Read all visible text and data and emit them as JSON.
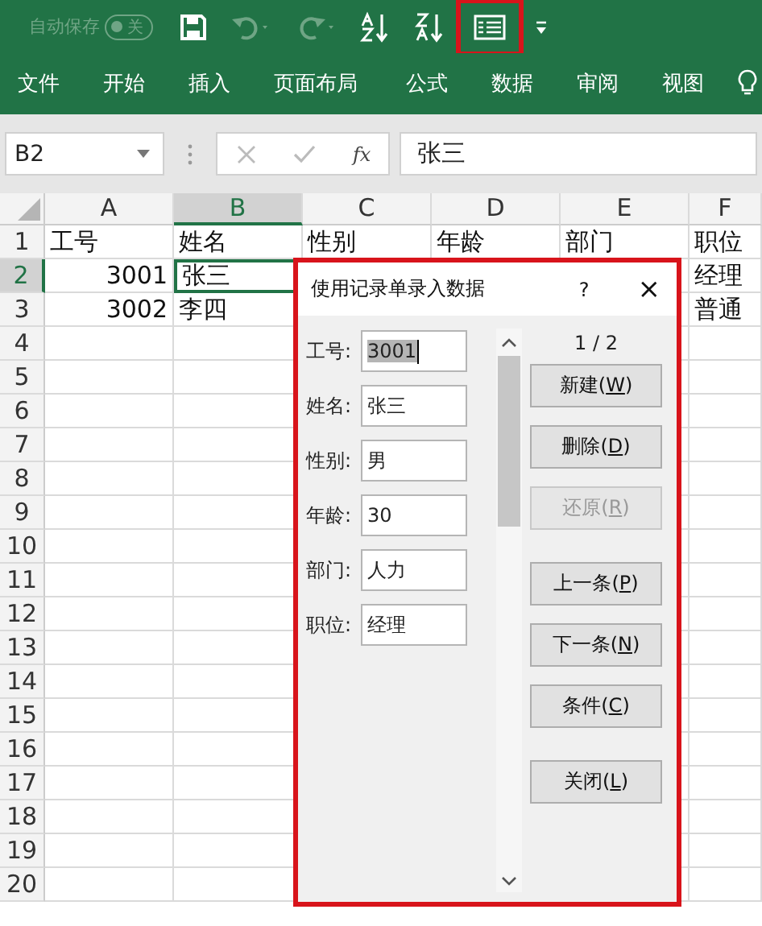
{
  "quick_access": {
    "autosave": {
      "label": "自动保存",
      "state_text": "关",
      "on": false
    },
    "tools": [
      {
        "kind": "save",
        "disabled": false,
        "highlighted": false
      },
      {
        "kind": "undo",
        "disabled": true,
        "highlighted": false
      },
      {
        "kind": "redo",
        "disabled": true,
        "highlighted": false
      },
      {
        "kind": "sort-asc",
        "disabled": false,
        "highlighted": false
      },
      {
        "kind": "sort-desc",
        "disabled": false,
        "highlighted": false
      },
      {
        "kind": "form",
        "disabled": false,
        "highlighted": true
      },
      {
        "kind": "customize",
        "disabled": false,
        "highlighted": false
      }
    ]
  },
  "ribbon_tabs": [
    {
      "label": "文件"
    },
    {
      "label": "开始"
    },
    {
      "label": "插入"
    },
    {
      "label": "页面布局"
    },
    {
      "label": "公式"
    },
    {
      "label": "数据"
    },
    {
      "label": "审阅"
    },
    {
      "label": "视图"
    }
  ],
  "formula_bar": {
    "name_box": "B2",
    "function_label": "fx",
    "content": "张三"
  },
  "sheet": {
    "columns": [
      {
        "label": "A",
        "selected": false
      },
      {
        "label": "B",
        "selected": true
      },
      {
        "label": "C",
        "selected": false
      },
      {
        "label": "D",
        "selected": false
      },
      {
        "label": "E",
        "selected": false
      },
      {
        "label": "F",
        "selected": false
      }
    ],
    "rows": [
      {
        "label": "1",
        "selected": false,
        "cells": [
          {
            "text": "工号",
            "kind": "text",
            "active": false
          },
          {
            "text": "姓名",
            "kind": "text",
            "active": false
          },
          {
            "text": "性别",
            "kind": "text",
            "active": false
          },
          {
            "text": "年龄",
            "kind": "text",
            "active": false
          },
          {
            "text": "部门",
            "kind": "text",
            "active": false
          },
          {
            "text": "职位",
            "kind": "text",
            "active": false
          }
        ]
      },
      {
        "label": "2",
        "selected": true,
        "cells": [
          {
            "text": "3001",
            "kind": "number",
            "active": false
          },
          {
            "text": "张三",
            "kind": "text",
            "active": true
          },
          {
            "kind": "empty"
          },
          {
            "kind": "empty"
          },
          {
            "kind": "empty"
          },
          {
            "text": "经理",
            "kind": "text",
            "active": false
          }
        ]
      },
      {
        "label": "3",
        "selected": false,
        "cells": [
          {
            "text": "3002",
            "kind": "number",
            "active": false
          },
          {
            "text": "李四",
            "kind": "text",
            "active": false
          },
          {
            "kind": "empty"
          },
          {
            "kind": "empty"
          },
          {
            "kind": "empty"
          },
          {
            "text": "普通",
            "kind": "text",
            "active": false
          }
        ]
      },
      {
        "label": "4",
        "selected": false,
        "cells": []
      },
      {
        "label": "5",
        "selected": false,
        "cells": []
      },
      {
        "label": "6",
        "selected": false,
        "cells": []
      },
      {
        "label": "7",
        "selected": false,
        "cells": []
      },
      {
        "label": "8",
        "selected": false,
        "cells": []
      },
      {
        "label": "9",
        "selected": false,
        "cells": []
      },
      {
        "label": "10",
        "selected": false,
        "cells": []
      },
      {
        "label": "11",
        "selected": false,
        "cells": []
      },
      {
        "label": "12",
        "selected": false,
        "cells": []
      },
      {
        "label": "13",
        "selected": false,
        "cells": []
      },
      {
        "label": "14",
        "selected": false,
        "cells": []
      },
      {
        "label": "15",
        "selected": false,
        "cells": []
      },
      {
        "label": "16",
        "selected": false,
        "cells": []
      },
      {
        "label": "17",
        "selected": false,
        "cells": []
      },
      {
        "label": "18",
        "selected": false,
        "cells": []
      },
      {
        "label": "19",
        "selected": false,
        "cells": []
      },
      {
        "label": "20",
        "selected": false,
        "cells": []
      }
    ]
  },
  "dialog": {
    "title": "使用记录单录入数据",
    "help": "?",
    "close": "×",
    "highlighted": true,
    "counter": "1 / 2",
    "fields": [
      {
        "label": "工号:",
        "value": "3001",
        "selected": true
      },
      {
        "label": "姓名:",
        "value": "张三",
        "selected": false
      },
      {
        "label": "性别:",
        "value": "男",
        "selected": false
      },
      {
        "label": "年龄:",
        "value": "30",
        "selected": false
      },
      {
        "label": "部门:",
        "value": "人力",
        "selected": false
      },
      {
        "label": "职位:",
        "value": "经理",
        "selected": false
      }
    ],
    "button_groups": [
      [
        {
          "before": "新建(",
          "key": "W",
          "after": ")",
          "disabled": false
        },
        {
          "before": "删除(",
          "key": "D",
          "after": ")",
          "disabled": false
        },
        {
          "before": "还原(",
          "key": "R",
          "after": ")",
          "disabled": true
        }
      ],
      [
        {
          "before": "上一条(",
          "key": "P",
          "after": ")",
          "disabled": false
        },
        {
          "before": "下一条(",
          "key": "N",
          "after": ")",
          "disabled": false
        },
        {
          "before": "条件(",
          "key": "C",
          "after": ")",
          "disabled": false
        }
      ],
      [
        {
          "before": "关闭(",
          "key": "L",
          "after": ")",
          "disabled": false
        }
      ]
    ]
  }
}
